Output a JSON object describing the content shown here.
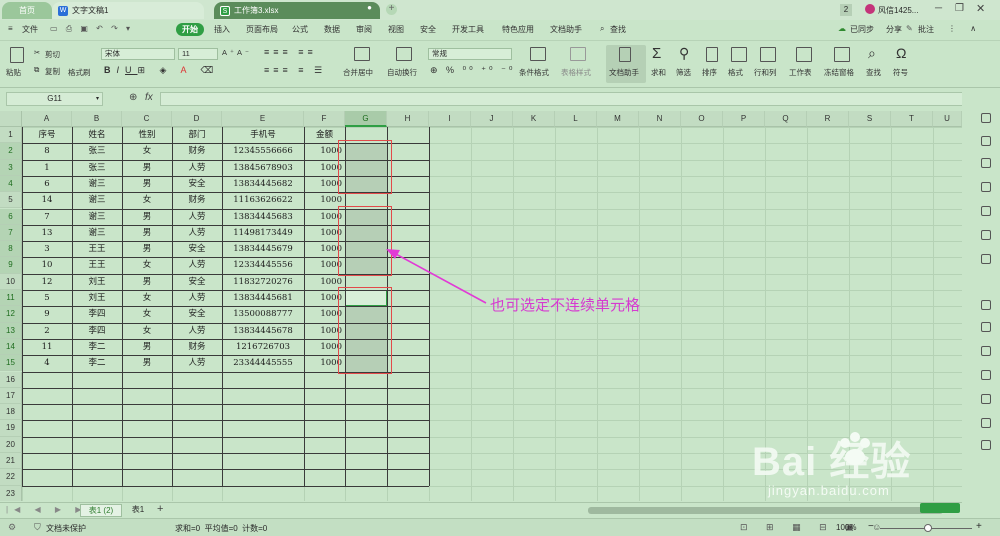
{
  "titlebar": {
    "home_tab": "首页",
    "doc_tab": "文字文稿1",
    "active_tab": "工作簿3.xlsx",
    "badge": "2",
    "user": "风信1425..."
  },
  "menubar": {
    "file": "文件",
    "items": [
      "开始",
      "插入",
      "页面布局",
      "公式",
      "数据",
      "审阅",
      "视图",
      "安全",
      "开发工具",
      "特色应用",
      "文档助手"
    ],
    "search": "查找",
    "sync": "已同步",
    "share": "分享",
    "comment": "批注"
  },
  "ribbon": {
    "paste": "粘贴",
    "cut": "剪切",
    "copy": "复制",
    "format_painter": "格式刷",
    "font_name": "宋体",
    "font_size": "11",
    "merge": "合并居中",
    "wrap": "自动换行",
    "num_format": "常规",
    "cond_format": "条件格式",
    "table_style": "表格样式",
    "doc_helper": "文档助手",
    "sum": "求和",
    "filter": "筛选",
    "sort": "排序",
    "format": "格式",
    "rows_cols": "行和列",
    "worksheet": "工作表",
    "freeze": "冻结窗格",
    "find": "查找",
    "symbol": "符号"
  },
  "formula": {
    "namebox": "G11",
    "fx": "fx"
  },
  "columns": [
    "A",
    "B",
    "C",
    "D",
    "E",
    "F",
    "G",
    "H",
    "I",
    "J",
    "K",
    "L",
    "M",
    "N",
    "O",
    "P",
    "Q",
    "R",
    "S",
    "T",
    "U"
  ],
  "rows": [
    "1",
    "2",
    "3",
    "4",
    "5",
    "6",
    "7",
    "8",
    "9",
    "10",
    "11",
    "12",
    "13",
    "14",
    "15",
    "16",
    "17",
    "18",
    "19",
    "20",
    "21",
    "22",
    "23"
  ],
  "table": {
    "headers": [
      "序号",
      "姓名",
      "性别",
      "部门",
      "手机号",
      "金额"
    ],
    "rows": [
      [
        "8",
        "张三",
        "女",
        "财务",
        "12345556666",
        "1000"
      ],
      [
        "1",
        "张三",
        "男",
        "人劳",
        "13845678903",
        "1000"
      ],
      [
        "6",
        "谢三",
        "男",
        "安全",
        "13834445682",
        "1000"
      ],
      [
        "14",
        "谢三",
        "女",
        "财务",
        "11163626622",
        "1000"
      ],
      [
        "7",
        "谢三",
        "男",
        "人劳",
        "13834445683",
        "1000"
      ],
      [
        "13",
        "谢三",
        "男",
        "人劳",
        "11498173449",
        "1000"
      ],
      [
        "3",
        "王王",
        "男",
        "安全",
        "13834445679",
        "1000"
      ],
      [
        "10",
        "王王",
        "女",
        "人劳",
        "12334445556",
        "1000"
      ],
      [
        "12",
        "刘王",
        "男",
        "安全",
        "11832720276",
        "1000"
      ],
      [
        "5",
        "刘王",
        "女",
        "人劳",
        "13834445681",
        "1000"
      ],
      [
        "9",
        "李四",
        "女",
        "安全",
        "13500088777",
        "1000"
      ],
      [
        "2",
        "李四",
        "女",
        "人劳",
        "13834445678",
        "1000"
      ],
      [
        "11",
        "李二",
        "男",
        "财务",
        "1216726703",
        "1000"
      ],
      [
        "4",
        "李二",
        "男",
        "人劳",
        "23344445555",
        "1000"
      ]
    ]
  },
  "annotation": "也可选定不连续单元格",
  "sheets": [
    "表1 (2)",
    "表1"
  ],
  "status": {
    "protect": "文档未保护",
    "stats": "求和=0  平均值=0  计数=0",
    "zoom": "100%"
  },
  "colors": {
    "accent": "#2f9e44",
    "red_box": "#e24a4a",
    "arrow": "#e13ad6",
    "annotation_text": "#d63ad0"
  },
  "watermark": {
    "brand": "Bai  经验",
    "url": "jingyan.baidu.com"
  }
}
